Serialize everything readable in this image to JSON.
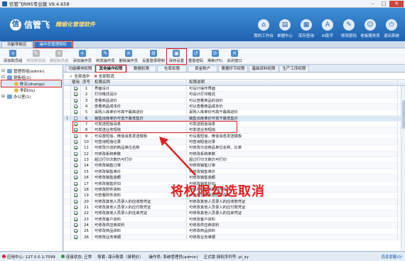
{
  "window": {
    "title": "信管飞RMS专业版 V9.4.658",
    "min": "–",
    "max": "□",
    "close": "✕"
  },
  "brand": {
    "logo": "信管飞",
    "mark": "信",
    "slogan": "精细化管理软件"
  },
  "top_buttons": [
    {
      "label": "我的工作台",
      "icon": "⌂"
    },
    {
      "label": "单据中心",
      "icon": "▤"
    },
    {
      "label": "库存查询",
      "icon": "▦"
    },
    {
      "label": "AI助手",
      "icon": "A"
    },
    {
      "label": "修改密码",
      "icon": "✎"
    },
    {
      "label": "老板服务员",
      "icon": "☺"
    },
    {
      "label": "退出系统",
      "icon": "⏻"
    }
  ],
  "nav_tabs": [
    {
      "label": "功能导航区"
    },
    {
      "label": "操作员管理授权"
    }
  ],
  "toolbar": [
    {
      "label": "添加职员组",
      "icon": "+",
      "disabled": false
    },
    {
      "label": "修改职员组",
      "icon": "✎",
      "disabled": true
    },
    {
      "label": "删除职员组",
      "icon": "✕",
      "disabled": true
    },
    {
      "label": "添加操作员",
      "icon": "+",
      "disabled": false
    },
    {
      "label": "修改操作员",
      "icon": "✎",
      "disabled": false
    },
    {
      "label": "删除操作员",
      "icon": "✕",
      "disabled": false
    },
    {
      "label": "设置登录限制",
      "icon": "⚙",
      "disabled": false
    },
    {
      "label": "保存设置",
      "icon": "▣",
      "disabled": false
    },
    {
      "label": "重置密码",
      "icon": "↺",
      "disabled": false
    },
    {
      "label": "刷新(F5)",
      "icon": "⟳",
      "disabled": false
    },
    {
      "label": "关闭窗口",
      "icon": "✕",
      "disabled": false
    }
  ],
  "tree": [
    {
      "label": "管理员组(admin)",
      "level": 0,
      "toggle": "⊟",
      "user": false
    },
    {
      "label": "销售组(1)",
      "level": 0,
      "toggle": "⊟",
      "user": false
    },
    {
      "label": "陈五(zhangs)",
      "level": 1,
      "toggle": "",
      "user": true
    },
    {
      "label": "李四(lis)",
      "level": 1,
      "toggle": "",
      "user": true
    },
    {
      "label": "办公室(1)",
      "level": 0,
      "toggle": "⊞",
      "user": false
    }
  ],
  "perm_tabs": [
    {
      "label": "功能模块权限"
    },
    {
      "label": "其他操作权限"
    },
    {
      "label": "数据权限"
    },
    {
      "label": "仓库权限"
    },
    {
      "label": "资金账户"
    },
    {
      "label": "票据环节权限"
    },
    {
      "label": "基础资料权限"
    },
    {
      "label": "生产工序权限"
    }
  ],
  "select_bar": {
    "all": "全部选中",
    "none": "全部取消"
  },
  "grid": {
    "headers": [
      "",
      "使用",
      "序号",
      "权限名称",
      "权限说明"
    ],
    "rows": [
      {
        "use": true,
        "no": "1",
        "name": "界面设计",
        "desc": "可设计操作界面"
      },
      {
        "use": true,
        "no": "2",
        "name": "打印格式设计",
        "desc": "可设计打印格式"
      },
      {
        "use": true,
        "no": "3",
        "name": "查看商品进价",
        "desc": "可以查看商品的进价"
      },
      {
        "use": true,
        "no": "4",
        "name": "查看商品成本价",
        "desc": "可以查看商品成本价"
      },
      {
        "use": true,
        "no": "5",
        "name": "采购入库单价可高于最高进价",
        "desc": "采购入库单价可高于最高进价"
      },
      {
        "use": false,
        "no": "6",
        "name": "销售出库单价可低于最低售价",
        "desc": "销售出库单价可低于最低售价",
        "marker": "I"
      },
      {
        "use": true,
        "no": "7",
        "name": "可发送短信消息",
        "desc": "可发送短信消息"
      },
      {
        "use": true,
        "no": "8",
        "name": "可发送业务短信",
        "desc": "可发送业务短信"
      },
      {
        "use": true,
        "no": "9",
        "name": "可设置短信、微信消息发送模板",
        "desc": "可设置短信、微信消息发送模板"
      },
      {
        "use": true,
        "no": "10",
        "name": "可查询短信记录",
        "desc": "可查询短信记录"
      },
      {
        "use": true,
        "no": "11",
        "name": "可修改分店的商品单位名称",
        "desc": "可修改分店商品单位名称、比率"
      },
      {
        "use": true,
        "no": "12",
        "name": "可修改系统参数",
        "desc": "可修改系统参数"
      },
      {
        "use": true,
        "no": "13",
        "name": "超过打印次数仍可打印",
        "desc": "超过打印次数仍可打印"
      },
      {
        "use": true,
        "no": "14",
        "name": "可修改销售订单",
        "desc": "可修改销售订单"
      },
      {
        "use": true,
        "no": "15",
        "name": "可修改销售单价",
        "desc": "可修改销售单价"
      },
      {
        "use": true,
        "no": "16",
        "name": "可修改销售金额",
        "desc": "可修改销售金额"
      },
      {
        "use": true,
        "no": "17",
        "name": "可修改销售折扣",
        "desc": "可修改销售折扣"
      },
      {
        "use": true,
        "no": "18",
        "name": "可修改附件资料",
        "desc": "可修改业务单据附件资料"
      },
      {
        "use": true,
        "no": "19",
        "name": "可查看附件资料",
        "desc": "可查看业务单据附件资料"
      },
      {
        "use": true,
        "no": "20",
        "name": "可修改其他人员录入的应收款凭证",
        "desc": "可修改其他人员录入的应收款凭证"
      },
      {
        "use": true,
        "no": "21",
        "name": "可修改其他人员录入的应付款凭证",
        "desc": "可修改其他人员录入的应付款凭证"
      },
      {
        "use": true,
        "no": "22",
        "name": "可修改其他人员录入的往来凭证",
        "desc": "可修改其他人员录入的往来凭证"
      },
      {
        "use": true,
        "no": "23",
        "name": "可修改客户资料",
        "desc": "可修改客户资料"
      },
      {
        "use": true,
        "no": "24",
        "name": "可修改供应商资料",
        "desc": "可修改供应商资料"
      },
      {
        "use": true,
        "no": "25",
        "name": "可修改商品资料",
        "desc": "可修改商品资料"
      },
      {
        "use": true,
        "no": "26",
        "name": "可修改业务单据",
        "desc": "可修改业务单据"
      }
    ]
  },
  "callout": "将权限勾选取消",
  "status": {
    "app": "应用中心: 127.0.0.1:7099",
    "conn": "连接状态: 正常",
    "acct": "账套: 演示账套（录税价）",
    "user": "操作员: 系统管理员(admin)",
    "auth": "正式版 授权序列号: pl_zy",
    "link": "消息提醒(0)"
  }
}
